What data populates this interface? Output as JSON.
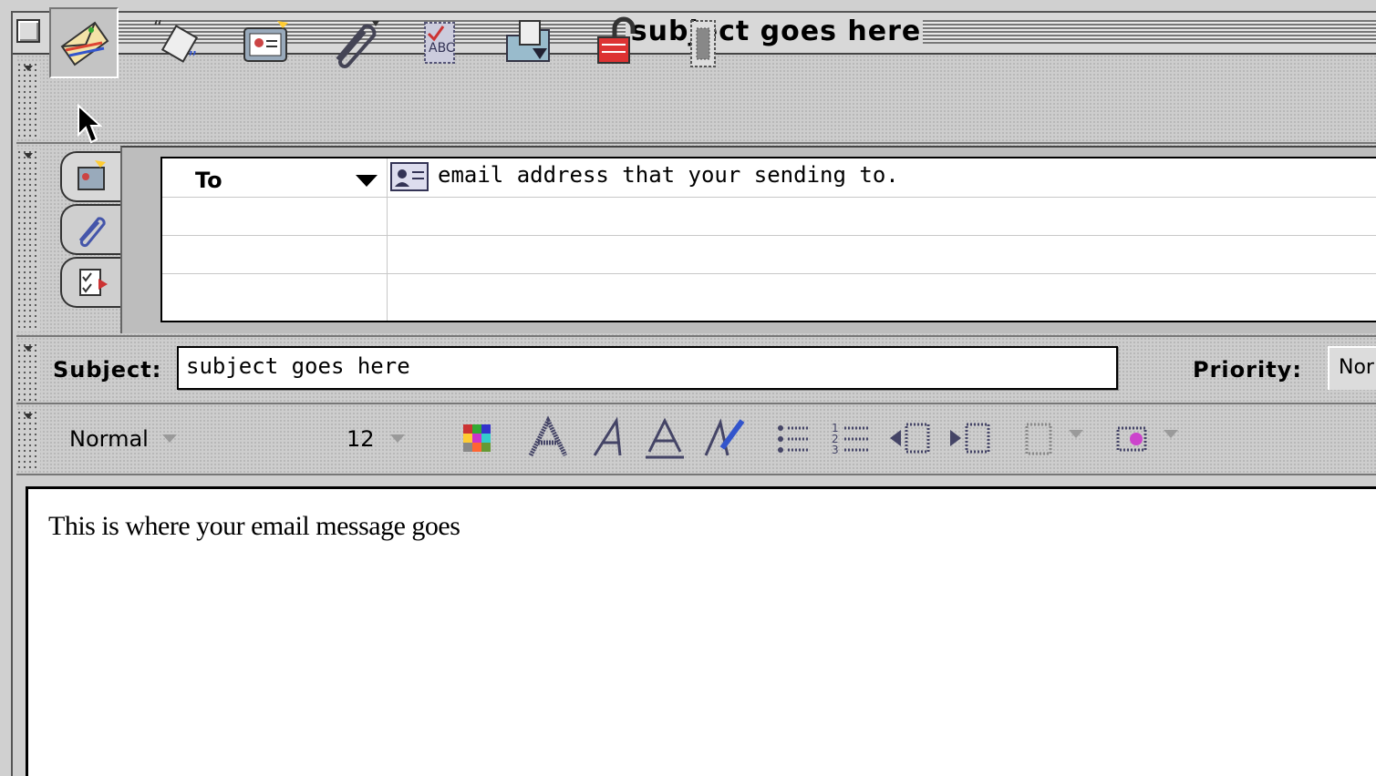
{
  "window": {
    "title": "subject goes here"
  },
  "address": {
    "field_type": "To",
    "recipient": "email address that your sending to."
  },
  "subject": {
    "label": "Subject:",
    "value": "subject goes here"
  },
  "priority": {
    "label": "Priority:",
    "value": "Nor"
  },
  "format": {
    "paragraph_style": "Normal",
    "font_size": "12"
  },
  "message": {
    "body": "This is where your email message goes"
  },
  "colors": {
    "chrome": "#cfcfcf",
    "text": "#000000",
    "field_bg": "#ffffff"
  }
}
